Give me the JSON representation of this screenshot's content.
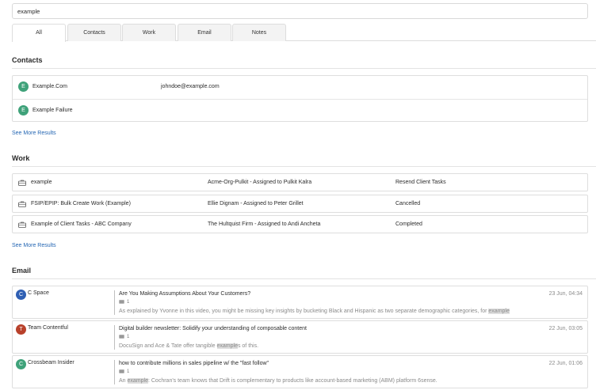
{
  "search": {
    "value": "example"
  },
  "tabs": [
    {
      "label": "All",
      "active": true
    },
    {
      "label": "Contacts",
      "active": false
    },
    {
      "label": "Work",
      "active": false
    },
    {
      "label": "Email",
      "active": false
    },
    {
      "label": "Notes",
      "active": false
    }
  ],
  "contacts": {
    "title": "Contacts",
    "rows": [
      {
        "initial": "E",
        "name": "Example.Com",
        "email": "johndoe@example.com"
      },
      {
        "initial": "E",
        "name": "Example Failure",
        "email": ""
      }
    ],
    "see_more": "See More Results"
  },
  "work": {
    "title": "Work",
    "rows": [
      {
        "name": "example",
        "assignment": "Acme-Org-Pulkit - Assigned to Pulkit Kalra",
        "status": "Resend Client Tasks"
      },
      {
        "name": "FSIP/EPIP: Bulk Create Work (Example)",
        "assignment": "Ellie Dignam - Assigned to Peter Grillet",
        "status": "Cancelled"
      },
      {
        "name": "Example of Client Tasks - ABC Company",
        "assignment": "The Hultquist Firm - Assigned to Andi Ancheta",
        "status": "Completed"
      }
    ],
    "see_more": "See More Results"
  },
  "email": {
    "title": "Email",
    "rows": [
      {
        "initial": "C",
        "avatar_color": "#2f5fb3",
        "sender": "C Space",
        "subject": "Are You Making Assumptions About Your Customers?",
        "count": "1",
        "snippet_before": "As explained by Yvonne in this video, you might be missing key insights by  bucketing Black and Hispanic as two separate demographic categories, for ",
        "snippet_highlight": "example",
        "snippet_after": "",
        "date": "23 Jun, 04:34"
      },
      {
        "initial": "T",
        "avatar_color": "#b8412b",
        "sender": "Team Contentful",
        "subject": "Digital builder newsletter: Solidify your understanding of composable content",
        "count": "1",
        "snippet_before": "DocuSign and Ace & Tate offer tangible ",
        "snippet_highlight": "example",
        "snippet_after": "s of this.",
        "date": "22 Jun, 03:05"
      },
      {
        "initial": "C",
        "avatar_color": "#3fa27a",
        "sender": "Crossbeam Insider",
        "subject": "how to contribute millions in sales pipeline w/ the \"fast follow\"",
        "count": "1",
        "snippet_before": "An ",
        "snippet_highlight": "example",
        "snippet_after": ": Cochran's team knows that Drift is complementary to products like account-based marketing (ABM) platform 6sense.",
        "date": "22 Jun, 01:06"
      }
    ]
  },
  "colors": {
    "link": "#2466b3",
    "avatar_green": "#3fa27a"
  }
}
